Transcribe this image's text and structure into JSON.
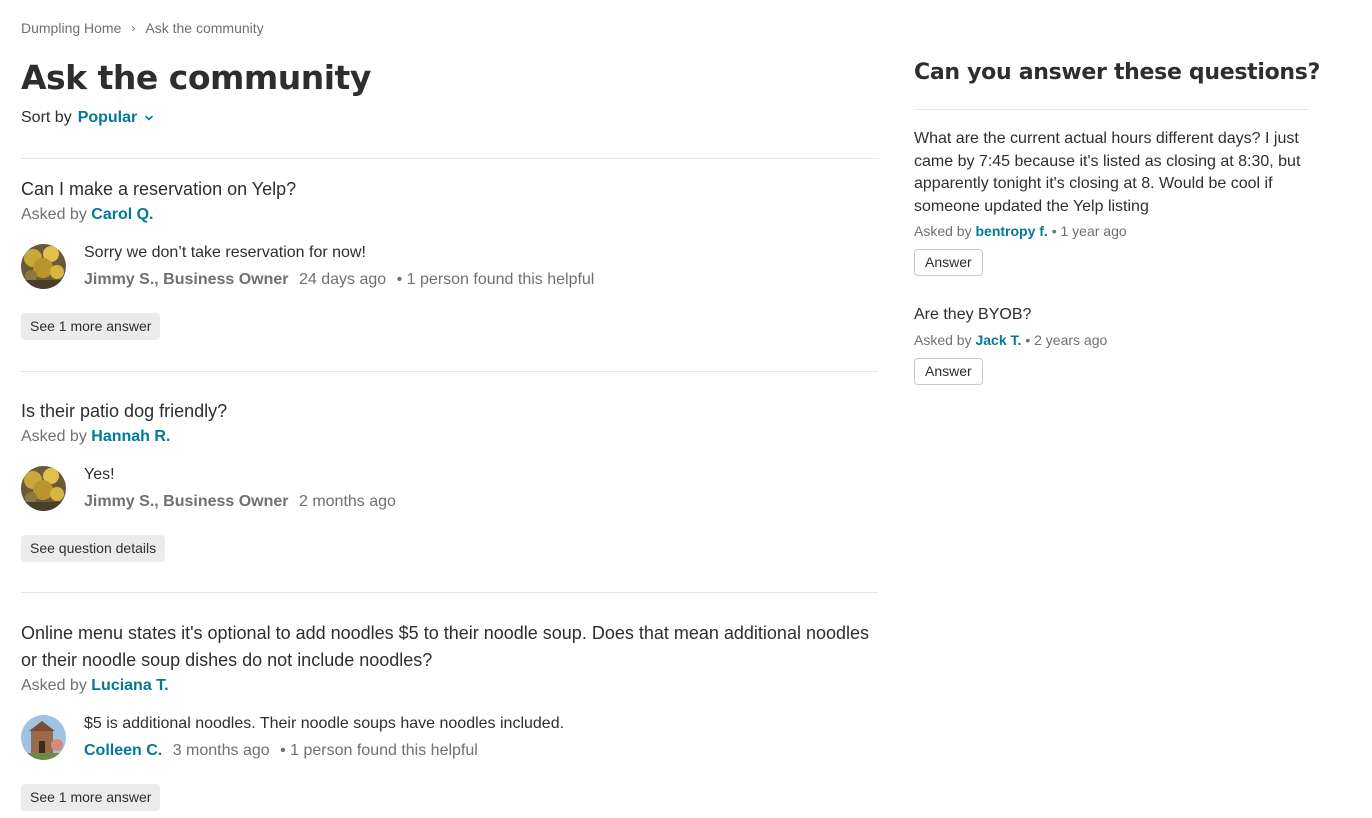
{
  "breadcrumb": {
    "home": "Dumpling Home",
    "current": "Ask the community"
  },
  "page_title": "Ask the community",
  "sort": {
    "label": "Sort by",
    "value": "Popular"
  },
  "questions": [
    {
      "title": "Can I make a reservation on Yelp?",
      "asked_prefix": "Asked by",
      "asker": "Carol Q.",
      "answer_text": "Sorry we don’t take reservation for now!",
      "answer_author": "Jimmy S., Business Owner",
      "answer_time": "24 days ago",
      "helpful": "• 1 person found this helpful",
      "button": "See 1 more answer"
    },
    {
      "title": "Is their patio dog friendly?",
      "asked_prefix": "Asked by",
      "asker": "Hannah R.",
      "answer_text": "Yes!",
      "answer_author": "Jimmy S., Business Owner",
      "answer_time": "2 months ago",
      "helpful": "",
      "button": "See question details"
    },
    {
      "title": "Online menu states it's optional to add noodles $5 to their noodle soup. Does that mean additional noodles or their noodle soup dishes do not include noodles?",
      "asked_prefix": "Asked by",
      "asker": "Luciana T.",
      "answer_text": "$5 is additional noodles. Their noodle soups have noodles included.",
      "answer_author": "Colleen C.",
      "answer_time": "3 months ago",
      "helpful": "• 1 person found this helpful",
      "button": "See 1 more answer"
    }
  ],
  "sidebar": {
    "title": "Can you answer these questions?",
    "questions": [
      {
        "text": "What are the current actual hours different days? I just came by 7:45 because it's listed as closing at 8:30, but apparently tonight it's closing at 8. Would be cool if someone updated the Yelp listing",
        "asked_prefix": "Asked by",
        "asker": "bentropy f.",
        "time": "• 1 year ago",
        "button": "Answer"
      },
      {
        "text": "Are they BYOB?",
        "asked_prefix": "Asked by",
        "asker": "Jack T.",
        "time": "• 2 years ago",
        "button": "Answer"
      }
    ]
  },
  "colors": {
    "link": "#027a97",
    "text": "#2d2e2f",
    "muted": "#6e7072",
    "button_bg": "#ebebeb"
  },
  "icons": {
    "breadcrumb_separator": "chevron-right-icon",
    "sort_caret": "chevron-down-icon"
  }
}
